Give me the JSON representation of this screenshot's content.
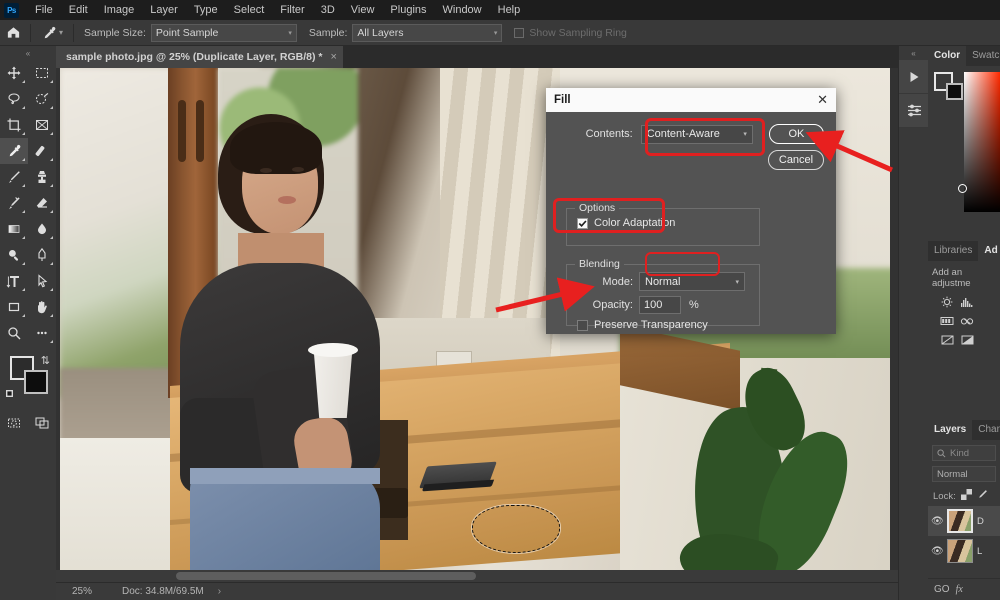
{
  "app": {
    "name": "Adobe Photoshop",
    "logo_text": "Ps"
  },
  "menubar": {
    "items": [
      {
        "label": "File"
      },
      {
        "label": "Edit"
      },
      {
        "label": "Image"
      },
      {
        "label": "Layer"
      },
      {
        "label": "Type"
      },
      {
        "label": "Select"
      },
      {
        "label": "Filter"
      },
      {
        "label": "3D"
      },
      {
        "label": "View"
      },
      {
        "label": "Plugins"
      },
      {
        "label": "Window"
      },
      {
        "label": "Help"
      }
    ]
  },
  "options_bar": {
    "home_icon": "home-icon",
    "tool_icon": "eyedropper-icon",
    "sample_size_label": "Sample Size:",
    "sample_size_value": "Point Sample",
    "sample_label": "Sample:",
    "sample_value": "All Layers",
    "show_sampling_ring_label": "Show Sampling Ring",
    "show_sampling_ring_checked": false
  },
  "toolbar": {
    "collapse_label": "«",
    "tools": [
      {
        "name": "move-tool",
        "active": false
      },
      {
        "name": "rectangular-marquee-tool",
        "active": false
      },
      {
        "name": "lasso-tool",
        "active": false
      },
      {
        "name": "object-selection-tool",
        "active": false
      },
      {
        "name": "crop-tool",
        "active": false
      },
      {
        "name": "frame-tool",
        "active": false
      },
      {
        "name": "eyedropper-tool",
        "active": true
      },
      {
        "name": "healing-brush-tool",
        "active": false
      },
      {
        "name": "brush-tool",
        "active": false
      },
      {
        "name": "clone-stamp-tool",
        "active": false
      },
      {
        "name": "history-brush-tool",
        "active": false
      },
      {
        "name": "eraser-tool",
        "active": false
      },
      {
        "name": "gradient-tool",
        "active": false
      },
      {
        "name": "blur-tool",
        "active": false
      },
      {
        "name": "dodge-tool",
        "active": false
      },
      {
        "name": "pen-tool",
        "active": false
      },
      {
        "name": "type-tool",
        "active": false
      },
      {
        "name": "path-selection-tool",
        "active": false
      },
      {
        "name": "shape-tool",
        "active": false
      },
      {
        "name": "hand-tool",
        "active": false
      },
      {
        "name": "zoom-tool",
        "active": false
      },
      {
        "name": "edit-toolbar-tool",
        "active": false
      }
    ],
    "foreground_color": "#2c2c2c",
    "background_color": "#0d0d0d",
    "quick_mask_name": "quick-mask-mode",
    "screen_mode_name": "screen-mode"
  },
  "document": {
    "tab_title": "sample photo.jpg @ 25% (Duplicate Layer, RGB/8) *",
    "close_glyph": "×"
  },
  "status_bar": {
    "zoom": "25%",
    "doc_info": "Doc: 34.8M/69.5M",
    "arrow_glyph": "›"
  },
  "dialog": {
    "title": "Fill",
    "close_glyph": "✕",
    "contents_label": "Contents:",
    "contents_value": "Content-Aware",
    "ok_label": "OK",
    "cancel_label": "Cancel",
    "options_group_label": "Options",
    "color_adaptation_label": "Color Adaptation",
    "color_adaptation_checked": true,
    "blending_group_label": "Blending",
    "mode_label": "Mode:",
    "mode_value": "Normal",
    "opacity_label": "Opacity:",
    "opacity_value": "100",
    "opacity_unit": "%",
    "preserve_transparency_label": "Preserve Transparency",
    "preserve_transparency_checked": false
  },
  "right_rail": {
    "collapse_label": "«",
    "buttons": [
      {
        "name": "play-action-button",
        "icon": "play-icon"
      },
      {
        "name": "properties-button",
        "icon": "sliders-icon"
      }
    ]
  },
  "panels": {
    "color_group": {
      "tabs": [
        {
          "label": "Color",
          "active": true
        },
        {
          "label": "Swatch",
          "active": false
        }
      ]
    },
    "libraries_group": {
      "tabs": [
        {
          "label": "Libraries",
          "active": false
        },
        {
          "label": "Ad",
          "active": true
        }
      ],
      "title": "Add an adjustme",
      "adjustment_icons": [
        "brightness-contrast-icon",
        "levels-icon",
        "curves-icon",
        "exposure-icon",
        "vibrance-icon",
        "hue-saturation-icon",
        "color-balance-icon",
        "black-white-icon"
      ]
    },
    "layers_group": {
      "tabs": [
        {
          "label": "Layers",
          "active": true
        },
        {
          "label": "Chan",
          "active": false
        }
      ],
      "filter_placeholder": "Kind",
      "blend_mode": "Normal",
      "lock_label": "Lock:",
      "lock_icons": [
        "lock-transparent-pixels-icon",
        "lock-image-pixels-icon"
      ],
      "rows": [
        {
          "name": "D",
          "visible": true,
          "selected": true
        },
        {
          "name": "L",
          "visible": true,
          "selected": false
        }
      ],
      "footer": {
        "link_label": "GO",
        "fx_label": "fx"
      }
    }
  },
  "annotations": {
    "highlight_color": "#e02020",
    "arrow_color": "#e8201f",
    "highlights": [
      {
        "name": "contents-dropdown-highlight"
      },
      {
        "name": "color-adaptation-highlight"
      },
      {
        "name": "blending-mode-highlight"
      }
    ],
    "arrows": [
      {
        "name": "arrow-to-ok-button"
      },
      {
        "name": "arrow-to-opacity-field"
      }
    ]
  },
  "canvas": {
    "selection_name": "marching-ants-selection",
    "scene_description": "woman-in-cafe-photo"
  }
}
